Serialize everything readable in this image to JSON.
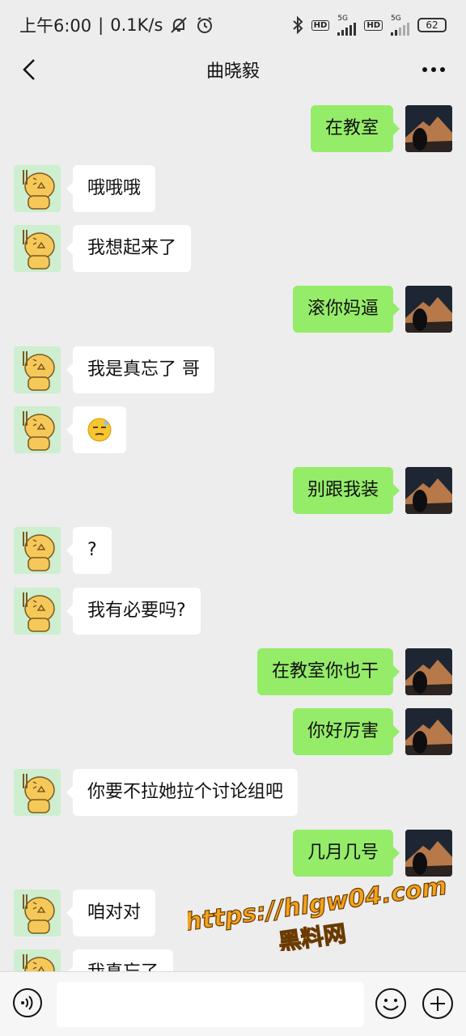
{
  "status_bar": {
    "time": "上午6:00",
    "net_speed": "0.1K/s",
    "sig1_label": "5G",
    "sig2_label": "5G",
    "hd1": "HD",
    "hd2": "HD",
    "battery": "62",
    "icons": [
      "mute-icon",
      "alarm-icon",
      "bluetooth-icon",
      "signal-icon",
      "battery-icon"
    ]
  },
  "header": {
    "title": "曲晓毅",
    "back_icon": "chevron-left-icon",
    "more_icon": "more-dots-icon"
  },
  "messages": [
    {
      "side": "right",
      "text": "在教室"
    },
    {
      "side": "left",
      "text": "哦哦哦"
    },
    {
      "side": "left",
      "text": "我想起来了"
    },
    {
      "side": "right",
      "text": "滚你妈逼"
    },
    {
      "side": "left",
      "text": "我是真忘了 哥"
    },
    {
      "side": "left",
      "text": "",
      "emoji": "smirk-face-emoji"
    },
    {
      "side": "right",
      "text": "别跟我装"
    },
    {
      "side": "left",
      "text": "?"
    },
    {
      "side": "left",
      "text": "我有必要吗?"
    },
    {
      "side": "right",
      "text": "在教室你也干"
    },
    {
      "side": "right",
      "text": "你好厉害"
    },
    {
      "side": "left",
      "text": "你要不拉她拉个讨论组吧"
    },
    {
      "side": "right",
      "text": "几月几号"
    },
    {
      "side": "left",
      "text": "咱对对"
    },
    {
      "side": "left",
      "text": "我真忘了"
    }
  ],
  "input_bar": {
    "value": "",
    "icons": [
      "voice-icon",
      "emoji-icon",
      "plus-icon"
    ]
  },
  "watermark": {
    "line1": "https://hlgw04.com",
    "line2": "黑料网",
    "color": "#f4a21c"
  },
  "colors": {
    "bg": "#ededed",
    "my_bubble": "#95ec69",
    "their_bubble": "#ffffff"
  }
}
